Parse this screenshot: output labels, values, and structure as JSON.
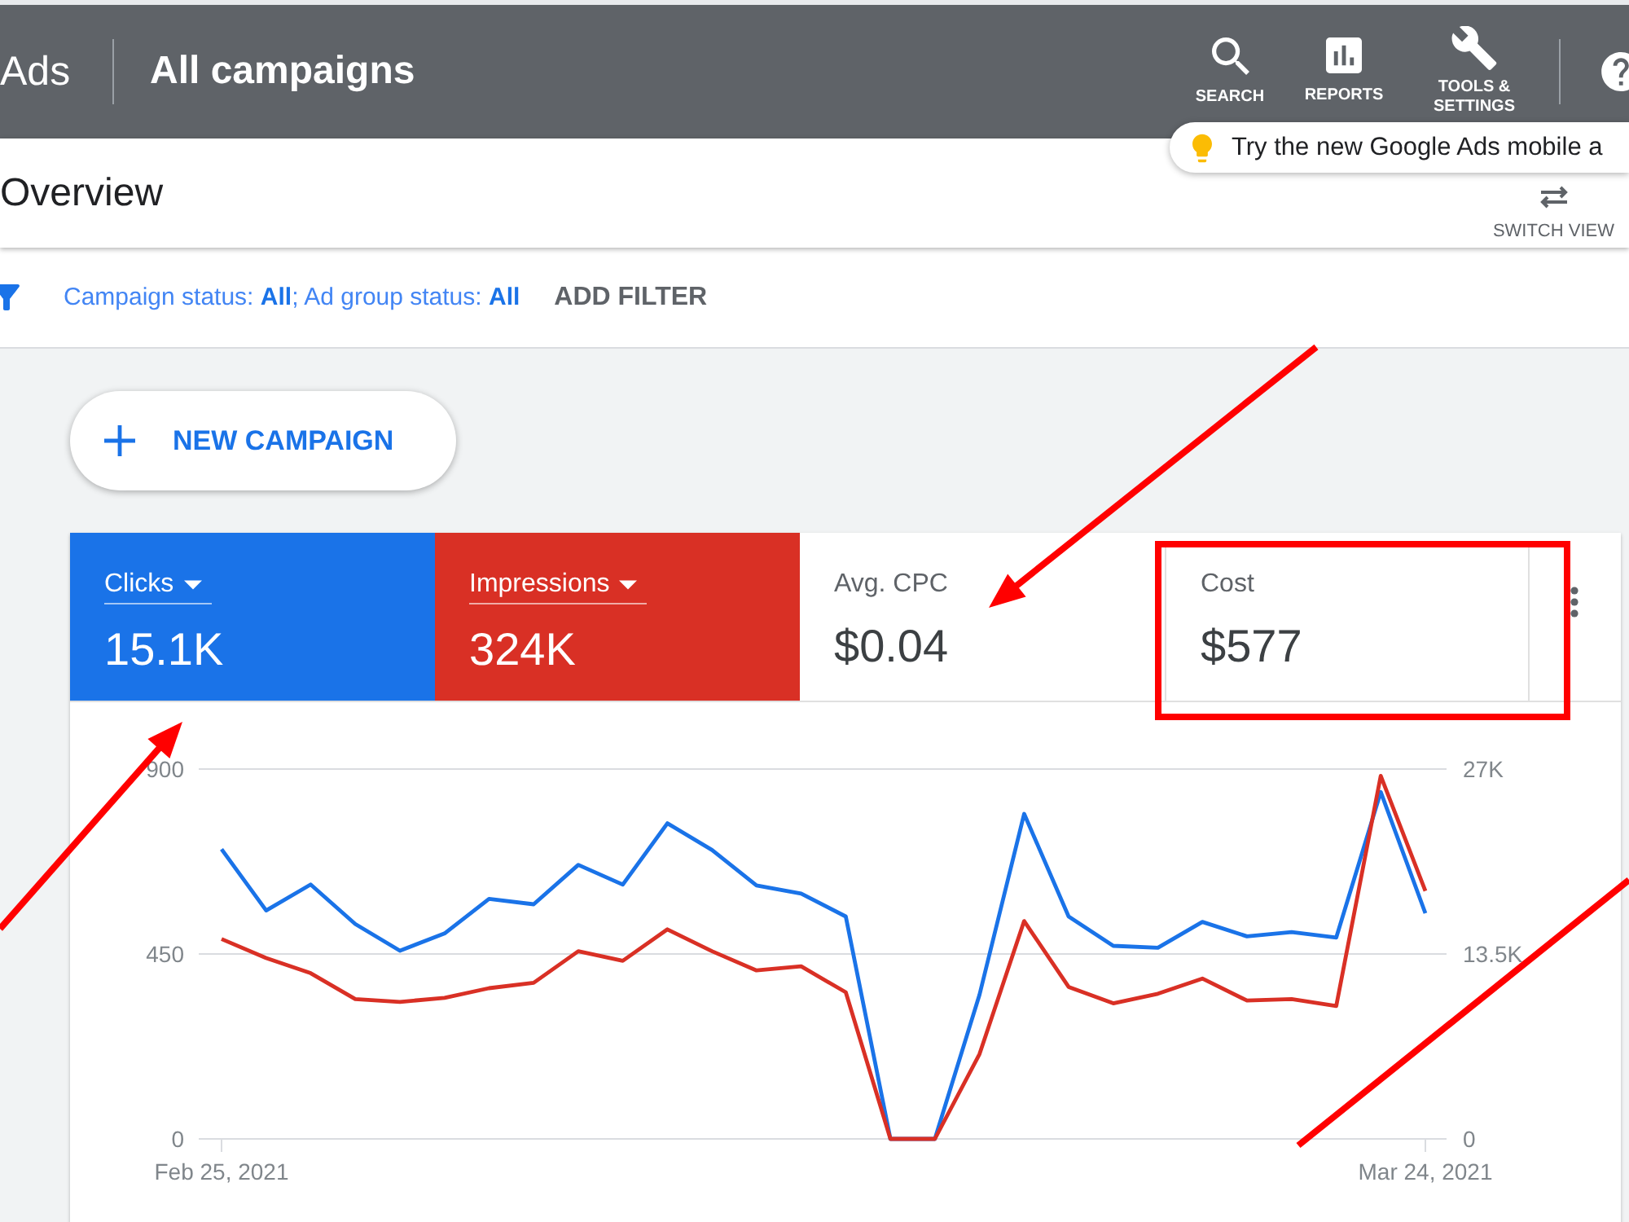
{
  "header": {
    "logo_text": "Ads",
    "title": "All campaigns",
    "nav": [
      {
        "kind": "search",
        "label": "SEARCH"
      },
      {
        "kind": "reports",
        "label": "REPORTS"
      },
      {
        "kind": "tools",
        "label": "TOOLS & SETTINGS"
      }
    ]
  },
  "tooltip": {
    "text": "Try the new Google Ads mobile a"
  },
  "page_header": {
    "title": "Overview",
    "switch_view": "SWITCH VIEW"
  },
  "filter_bar": {
    "filter_text": "Campaign status: **All**; Ad group status: **All**",
    "add_filter": "ADD FILTER"
  },
  "new_campaign_button": "NEW CAMPAIGN",
  "card": {
    "metrics": [
      {
        "label": "Clicks",
        "value": "15.1K",
        "selected": true,
        "hovered": false,
        "color": "#1a73e8"
      },
      {
        "label": "Impressions",
        "value": "324K",
        "selected": true,
        "hovered": false,
        "color": "#d93025"
      },
      {
        "label": "Avg. CPC",
        "value": "$0.04",
        "selected": false,
        "hovered": false
      },
      {
        "label": "Cost",
        "value": "$577",
        "selected": false,
        "hovered": true
      }
    ],
    "chart_data": {
      "type": "line",
      "categories": [
        "Feb 25, 2021",
        null,
        null,
        null,
        null,
        null,
        null,
        null,
        null,
        null,
        null,
        null,
        null,
        null,
        null,
        null,
        null,
        null,
        null,
        null,
        null,
        null,
        null,
        null,
        null,
        null,
        null,
        "Mar 24, 2021"
      ],
      "ylim": [
        0,
        900
      ],
      "yticks": [
        0,
        450,
        900
      ],
      "y2lim": [
        0,
        27000
      ],
      "y2ticks": [
        {
          "value": 0,
          "label": "0"
        },
        {
          "value": 13500,
          "label": "13.5K"
        },
        {
          "value": 27000,
          "label": "27K"
        }
      ],
      "series": [
        {
          "color": "#1a73e8",
          "values": [
            705,
            556,
            619,
            523,
            458,
            500,
            584,
            571,
            667,
            619,
            768,
            703,
            617,
            597,
            541,
            0,
            0,
            351,
            791,
            541,
            470,
            465,
            528,
            493,
            503,
            490,
            844,
            549
          ]
        },
        {
          "color": "#d93025",
          "axis": "y2",
          "values": [
            14600,
            13200,
            12100,
            10200,
            10000,
            10300,
            11000,
            11400,
            13700,
            13000,
            15300,
            13700,
            12300,
            12600,
            10700,
            0,
            0,
            6200,
            15900,
            11100,
            9900,
            10600,
            11700,
            10100,
            10200,
            9700,
            26500,
            18100
          ]
        }
      ]
    }
  },
  "annotations": [
    {
      "kind": "arrow"
    },
    {
      "kind": "arrow"
    },
    {
      "kind": "line"
    },
    {
      "kind": "frame"
    }
  ]
}
